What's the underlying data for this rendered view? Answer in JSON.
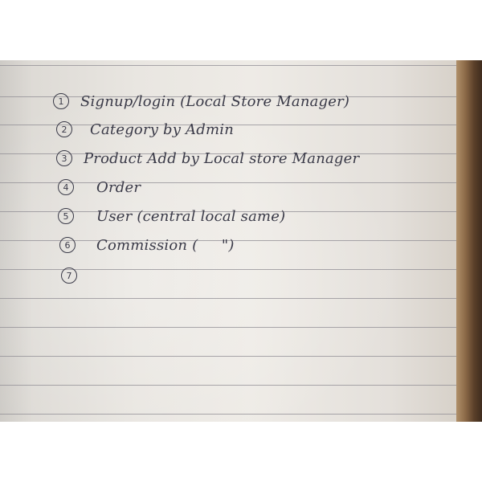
{
  "notebook": {
    "items": [
      {
        "number": "1",
        "text": "Signup/login (Local Store Manager)"
      },
      {
        "number": "2",
        "text": "Category by Admin"
      },
      {
        "number": "3",
        "text": "Product Add by Local store Manager"
      },
      {
        "number": "4",
        "text": "Order"
      },
      {
        "number": "5",
        "text": "User (central local same)"
      },
      {
        "number": "6",
        "text": "Commission (     \")"
      },
      {
        "number": "7",
        "text": ""
      }
    ]
  }
}
